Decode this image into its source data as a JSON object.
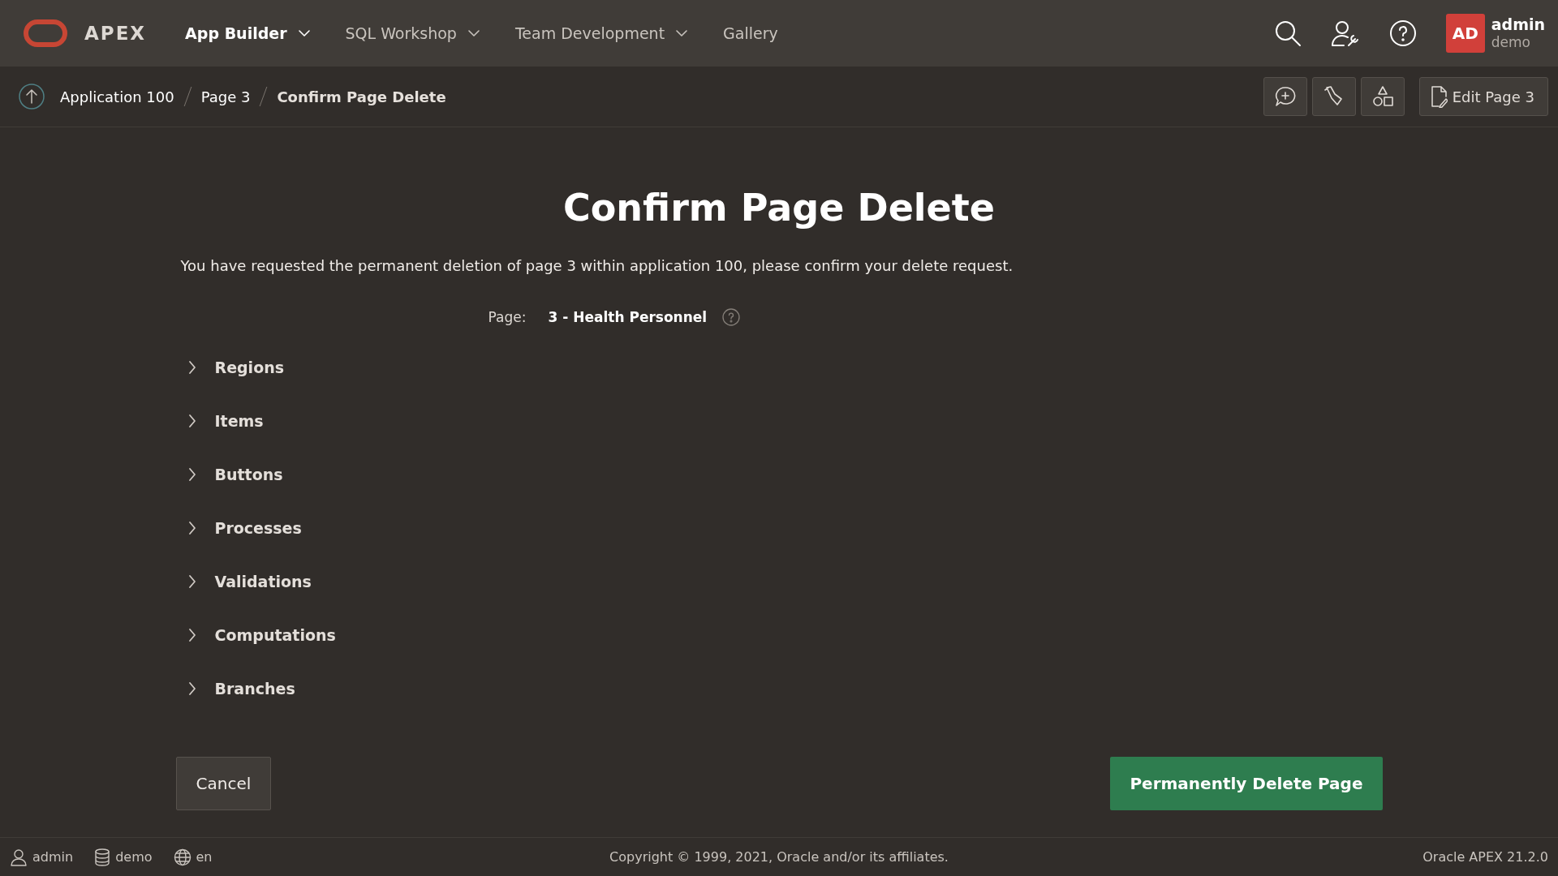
{
  "header": {
    "logo_text": "APEX",
    "nav": [
      {
        "label": "App Builder",
        "selected": true,
        "has_menu": true
      },
      {
        "label": "SQL Workshop",
        "selected": false,
        "has_menu": true
      },
      {
        "label": "Team Development",
        "selected": false,
        "has_menu": true
      },
      {
        "label": "Gallery",
        "selected": false,
        "has_menu": false
      }
    ],
    "user": {
      "initials": "AD",
      "name": "admin",
      "workspace": "demo"
    }
  },
  "breadcrumb": {
    "items": [
      {
        "label": "Application 100",
        "current": false
      },
      {
        "label": "Page 3",
        "current": false
      },
      {
        "label": "Confirm Page Delete",
        "current": true
      }
    ],
    "edit_button": "Edit Page 3"
  },
  "main": {
    "title": "Confirm Page Delete",
    "message": "You have requested the permanent deletion of page 3 within application 100, please confirm your delete request.",
    "page_field": {
      "label": "Page:",
      "value": "3 - Health Personnel"
    },
    "sections": [
      {
        "label": "Regions",
        "expanded": false
      },
      {
        "label": "Items",
        "expanded": false
      },
      {
        "label": "Buttons",
        "expanded": false
      },
      {
        "label": "Processes",
        "expanded": false
      },
      {
        "label": "Validations",
        "expanded": false
      },
      {
        "label": "Computations",
        "expanded": false
      },
      {
        "label": "Branches",
        "expanded": false
      }
    ],
    "cancel_button": "Cancel",
    "delete_button": "Permanently Delete Page"
  },
  "footer": {
    "user": "admin",
    "workspace": "demo",
    "language": "en",
    "copyright": "Copyright © 1999, 2021, Oracle and/or its affiliates.",
    "version": "Oracle APEX 21.2.0"
  }
}
